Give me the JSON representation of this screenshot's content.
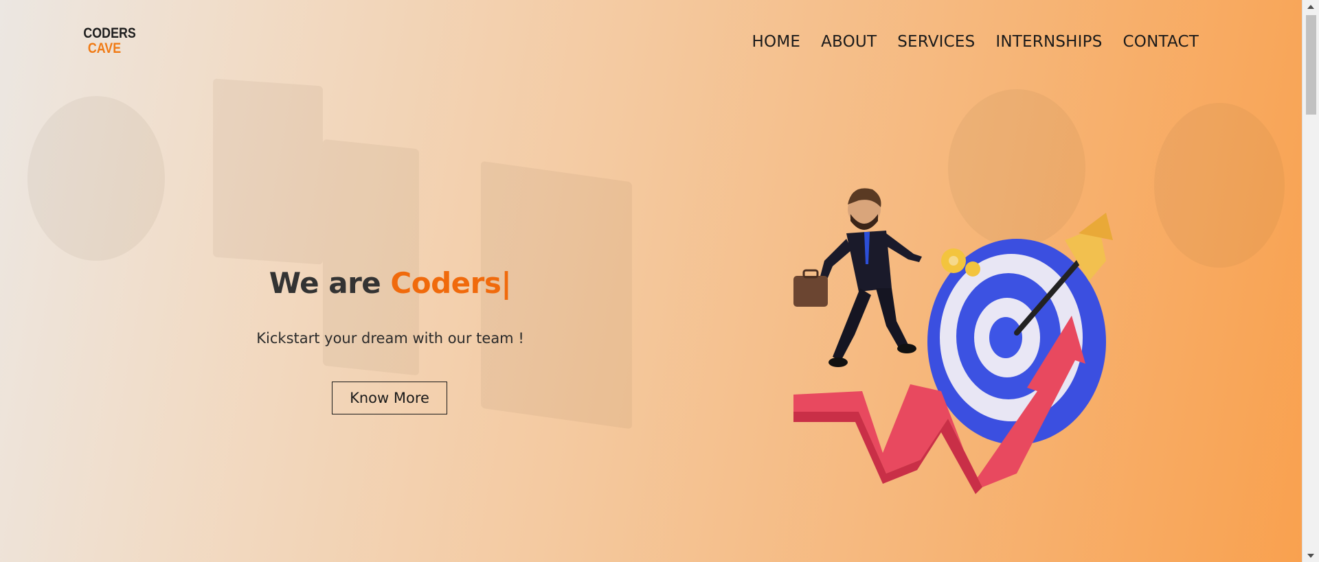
{
  "logo": {
    "line1": "CODERS",
    "line2": "CAVE"
  },
  "nav": {
    "items": [
      {
        "label": "HOME"
      },
      {
        "label": "ABOUT"
      },
      {
        "label": "SERVICES"
      },
      {
        "label": "INTERNSHIPS"
      },
      {
        "label": "CONTACT"
      }
    ]
  },
  "hero": {
    "headline_prefix": "We are ",
    "headline_accent": "Coders",
    "headline_caret": "|",
    "subtitle": "Kickstart your dream with our team !",
    "cta_label": "Know More"
  },
  "colors": {
    "accent": "#f06a0c",
    "text_dark": "#333333",
    "gradient_end": "#f9a14f"
  },
  "illustration": {
    "icon": "businessman-target-growth-illustration"
  }
}
